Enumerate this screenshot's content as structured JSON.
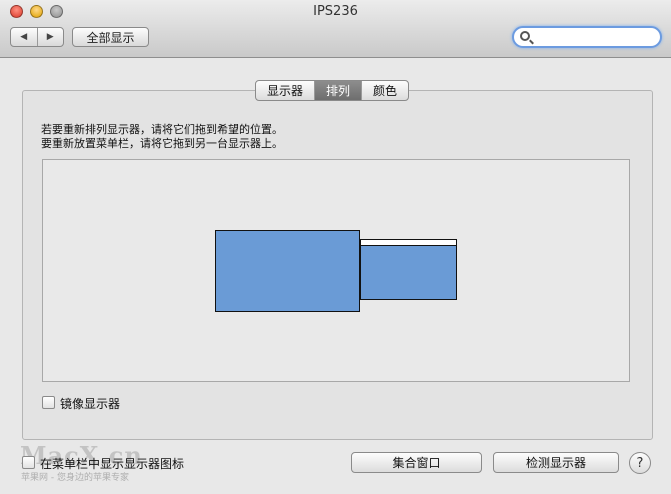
{
  "window": {
    "title": "IPS236"
  },
  "toolbar": {
    "back_glyph": "◀",
    "forward_glyph": "▶",
    "show_all_label": "全部显示",
    "search_placeholder": ""
  },
  "tabs": [
    {
      "label": "显示器",
      "selected": false
    },
    {
      "label": "排列",
      "selected": true
    },
    {
      "label": "颜色",
      "selected": false
    }
  ],
  "arrangement": {
    "instruction_line1": "若要重新排列显示器，请将它们拖到希望的位置。",
    "instruction_line2": "要重新放置菜单栏，请将它拖到另一台显示器上。",
    "display_color": "#6a9bd6"
  },
  "mirror_displays": {
    "label": "镜像显示器",
    "checked": false
  },
  "show_in_menubar": {
    "label": "在菜单栏中显示显示器图标",
    "checked": false
  },
  "buttons": {
    "gather_windows": "集合窗口",
    "detect_displays": "检测显示器",
    "help": "?"
  },
  "watermark": {
    "logo": "MacX.cn",
    "tagline": "苹果网 - 您身边的苹果专家"
  }
}
